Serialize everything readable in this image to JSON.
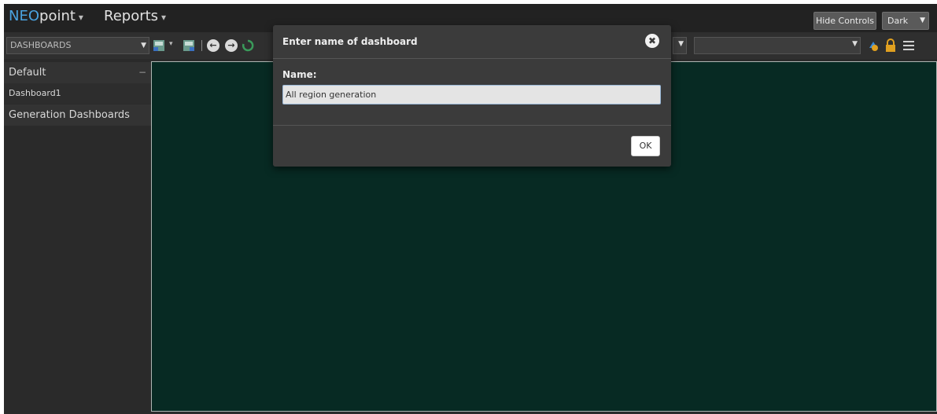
{
  "header": {
    "brand_neo": "NEO",
    "brand_point": "point",
    "brand_caret": "▾",
    "reports_label": "Reports",
    "reports_caret": "▾",
    "hide_controls_label": "Hide Controls",
    "theme_value": "Dark"
  },
  "toolbar": {
    "dashboard_select_value": "DASHBOARDS",
    "icons": [
      "save-dashboard-icon",
      "save-as-icon",
      "back-arrow-icon",
      "forward-arrow-icon",
      "refresh-icon",
      "download-icon",
      "lock-icon",
      "list-icon"
    ]
  },
  "sidebar": {
    "groups": [
      {
        "label": "Default",
        "items": [
          {
            "label": "Dashboard1"
          }
        ]
      },
      {
        "label": "Generation Dashboards",
        "items": []
      }
    ],
    "collapse_symbol": "−"
  },
  "modal": {
    "title": "Enter name of dashboard",
    "name_label": "Name:",
    "name_value": "All region generation",
    "ok_label": "OK",
    "close_symbol": "✖"
  },
  "colors": {
    "brand_accent": "#4aa3e0",
    "content_bg": "#072a23",
    "lock_icon": "#e0a020",
    "download_icon": "#3a8ad6"
  }
}
